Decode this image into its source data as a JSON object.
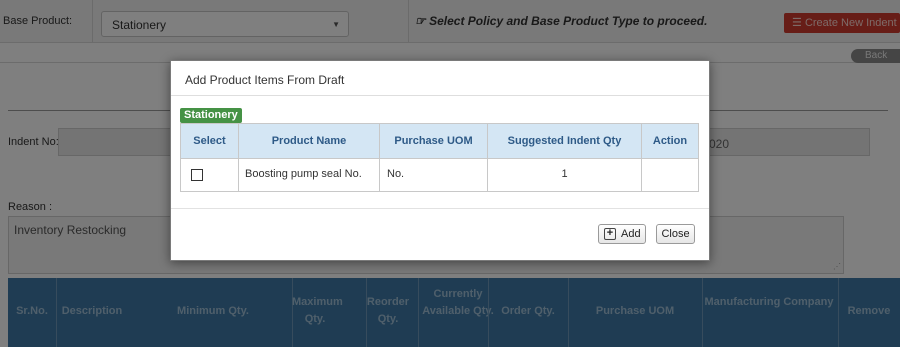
{
  "header": {
    "base_product_label": "Base Product:",
    "base_product_value": "Stationery",
    "hint_text": "Select Policy and Base Product Type to proceed.",
    "create_button": "Create New Indent",
    "back_button": "Back",
    "accent_color": "#cf3b2f"
  },
  "form": {
    "indent_no_label": "Indent No:",
    "date_fragment": "020",
    "reason_label": "Reason :",
    "reason_value": "Inventory Restocking"
  },
  "items_table": {
    "headers": [
      "Sr.No.",
      "Description",
      "Minimum Qty.",
      "Maximum Qty.",
      "Reorder Qty.",
      "Currently Available Qty.",
      "Order Qty.",
      "Purchase UOM",
      "Manufacturing Company",
      "Remove"
    ]
  },
  "modal": {
    "title": "Add Product Items From Draft",
    "category_tag": "Stationery",
    "columns": [
      "Select",
      "Product Name",
      "Purchase UOM",
      "Suggested Indent Qty",
      "Action"
    ],
    "rows": [
      {
        "selected": false,
        "product_name": "Boosting pump seal No.",
        "uom": "No.",
        "qty": "1",
        "action": ""
      }
    ],
    "add_button": "Add",
    "close_button": "Close"
  }
}
